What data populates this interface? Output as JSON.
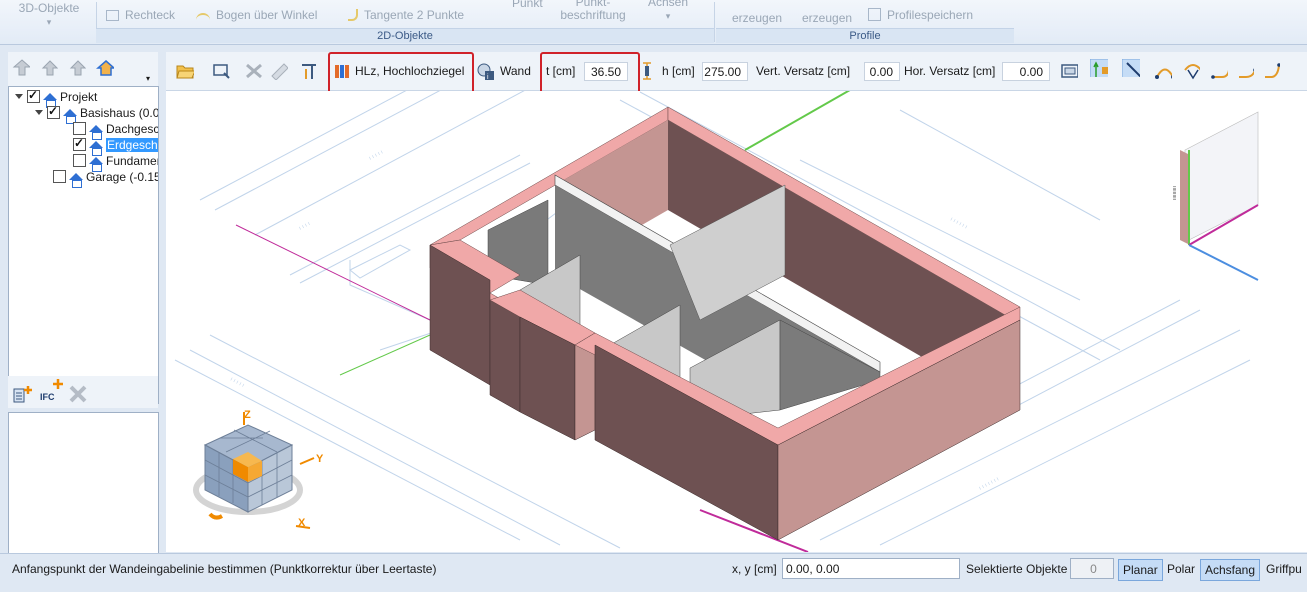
{
  "ribbon": {
    "big_left_label": "3D-Objekte",
    "items": {
      "rechteck": "Rechteck",
      "bogen": "Bogen über Winkel",
      "tangente": "Tangente 2 Punkte",
      "punkt": "Punkt",
      "punktbeschriftung_top": "Punkt-",
      "punktbeschriftung_bottom": "beschriftung",
      "achsen": "Achsen",
      "erzeugen1": "erzeugen",
      "erzeugen2": "erzeugen",
      "profilespeichern": "Profilespeichern"
    },
    "groups": {
      "objekte2d": "2D-Objekte",
      "profile": "Profile"
    }
  },
  "tree": {
    "rows": [
      {
        "label": "Projekt",
        "checked": true
      },
      {
        "label": "Basishaus (0.0",
        "checked": true
      },
      {
        "label": "Dachgesc",
        "checked": false
      },
      {
        "label": "Erdgescho",
        "checked": true,
        "selected": true
      },
      {
        "label": "Fundamen",
        "checked": false
      },
      {
        "label": "Garage (-0.150",
        "checked": false
      }
    ],
    "scroll_left": "‹",
    "scroll_right": "›"
  },
  "ifc": {
    "label": "IFC"
  },
  "toolbar": {
    "material": "HLz, Hochlochziegel",
    "element": "Wand",
    "t_label": "t [cm]",
    "t_value": "36.50",
    "h_label": "h [cm]",
    "h_value": "275.00",
    "vert_label": "Vert. Versatz [cm]",
    "vert_value": "0.00",
    "hor_label": "Hor. Versatz [cm]",
    "hor_value": "0.00"
  },
  "status": {
    "message": "Anfangspunkt der Wandeingabelinie bestimmen (Punktkorrektur über Leertaste)",
    "xy_label": "x, y [cm]",
    "xy_value": "0.00, 0.00",
    "selected_label": "Selektierte Objekte",
    "selected_value": "0",
    "planar": "Planar",
    "polar": "Polar",
    "achsfang": "Achsfang",
    "griffpunkt": "Griffpu"
  },
  "colors": {
    "highlight": "#d0222a",
    "wall_top": "#f0a8a8",
    "wall_outer_front": "#c49592",
    "wall_outer_left": "#6e5152",
    "inner_dark": "#707070",
    "inner_light": "#c8c8c8",
    "plan_lines": "#b8cde6"
  },
  "view_cube": {
    "axis_z": "Z",
    "axis_x": "X",
    "axis_y": "Y"
  }
}
